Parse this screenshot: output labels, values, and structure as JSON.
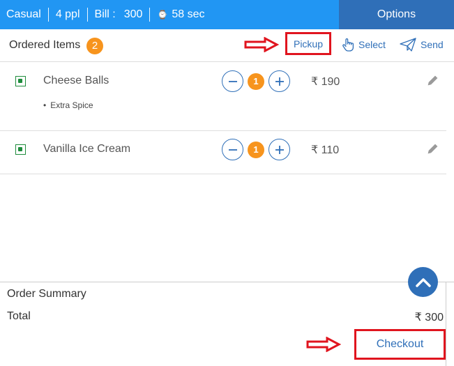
{
  "topbar": {
    "type": "Casual",
    "people": "4 ppl",
    "bill_label": "Bill :",
    "bill_value": "300",
    "timer": "58 sec",
    "options_label": "Options"
  },
  "header": {
    "title": "Ordered Items",
    "count": "2",
    "pickup_label": "Pickup",
    "select_label": "Select",
    "send_label": "Send"
  },
  "items": [
    {
      "name": "Cheese Balls",
      "modifier": "Extra Spice",
      "qty": "1",
      "price": "₹ 190"
    },
    {
      "name": "Vanilla Ice Cream",
      "qty": "1",
      "price": "₹ 110"
    }
  ],
  "summary": {
    "label": "Order Summary",
    "total_label": "Total",
    "total_value": "₹  300",
    "checkout_label": "Checkout"
  },
  "colors": {
    "primary": "#2196f3",
    "accent_blue": "#2f6fb8",
    "badge_orange": "#f7941d",
    "highlight_red": "#e0141e",
    "veg_green": "#1e8c3c"
  }
}
